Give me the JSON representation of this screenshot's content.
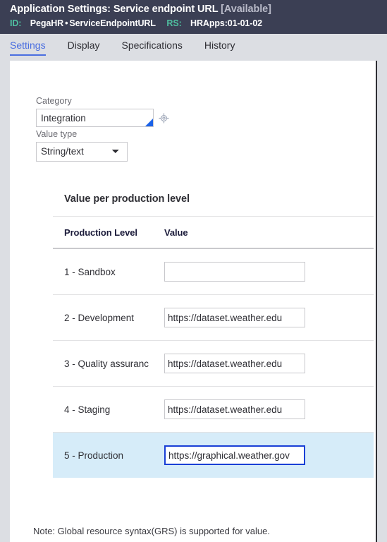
{
  "header": {
    "title_main": "Application Settings: Service endpoint URL",
    "title_status": "[Available]",
    "id_label": "ID:",
    "id_app": "PegaHR",
    "id_sep": "•",
    "id_rule": "ServiceEndpointURL",
    "rs_label": "RS:",
    "rs_value": "HRApps:01-01-02",
    "bg_color": "#3b3f54",
    "label_color": "#4fc0a0",
    "status_color": "#b9bbc9"
  },
  "tabs": [
    {
      "label": "Settings",
      "active": true
    },
    {
      "label": "Display",
      "active": false
    },
    {
      "label": "Specifications",
      "active": false
    },
    {
      "label": "History",
      "active": false
    }
  ],
  "tab_accent_color": "#4a6ee0",
  "form": {
    "category": {
      "label": "Category",
      "value": "Integration",
      "placeholder": ""
    },
    "value_type": {
      "label": "Value type",
      "selected": "String/text",
      "options": [
        "String/text"
      ]
    }
  },
  "table": {
    "title": "Value per production level",
    "columns": [
      "Production Level",
      "Value"
    ],
    "rows": [
      {
        "level": "1 - Sandbox",
        "value": "",
        "highlighted": false,
        "focused": false
      },
      {
        "level": "2 - Development",
        "value": "https://dataset.weather.edu",
        "highlighted": false,
        "focused": false
      },
      {
        "level": "3 - Quality assuranc",
        "value": "https://dataset.weather.edu",
        "highlighted": false,
        "focused": false
      },
      {
        "level": "4 - Staging",
        "value": "https://dataset.weather.edu",
        "highlighted": false,
        "focused": false
      },
      {
        "level": "5 - Production",
        "value": "https://graphical.weather.gov",
        "highlighted": true,
        "focused": true
      }
    ],
    "highlight_color": "#d6ecf9",
    "focus_border_color": "#1a3fd6"
  },
  "note": "Note: Global resource syntax(GRS) is supported for value."
}
